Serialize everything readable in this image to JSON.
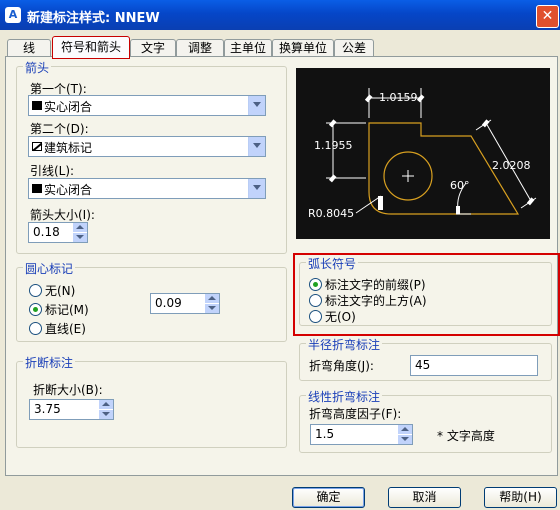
{
  "window": {
    "title": "新建标注样式: NNEW"
  },
  "tabs": [
    "线",
    "符号和箭头",
    "文字",
    "调整",
    "主单位",
    "换算单位",
    "公差"
  ],
  "arrows": {
    "legend": "箭头",
    "first_label": "第一个(T):",
    "first_value": "实心闭合",
    "second_label": "第二个(D):",
    "second_value": "建筑标记",
    "leader_label": "引线(L):",
    "leader_value": "实心闭合",
    "size_label": "箭头大小(I):",
    "size_value": "0.18"
  },
  "center_marks": {
    "legend": "圆心标记",
    "options": [
      "无(N)",
      "标记(M)",
      "直线(E)"
    ],
    "selected": 1,
    "size_value": "0.09"
  },
  "break": {
    "legend": "折断标注",
    "size_label": "折断大小(B):",
    "size_value": "3.75"
  },
  "preview": {
    "dim1": "1.0159",
    "dim2": "1.1955",
    "dim3": "2.0208",
    "angle": "60°",
    "radius": "R0.8045"
  },
  "arc_length": {
    "legend": "弧长符号",
    "options": [
      "标注文字的前缀(P)",
      "标注文字的上方(A)",
      "无(O)"
    ],
    "selected": 0
  },
  "radius_jog": {
    "legend": "半径折弯标注",
    "angle_label": "折弯角度(J):",
    "angle_value": "45"
  },
  "linear_jog": {
    "legend": "线性折弯标注",
    "factor_label": "折弯高度因子(F):",
    "factor_value": "1.5",
    "suffix": "* 文字高度"
  },
  "buttons": {
    "ok": "确定",
    "cancel": "取消",
    "help": "帮助(H)"
  }
}
